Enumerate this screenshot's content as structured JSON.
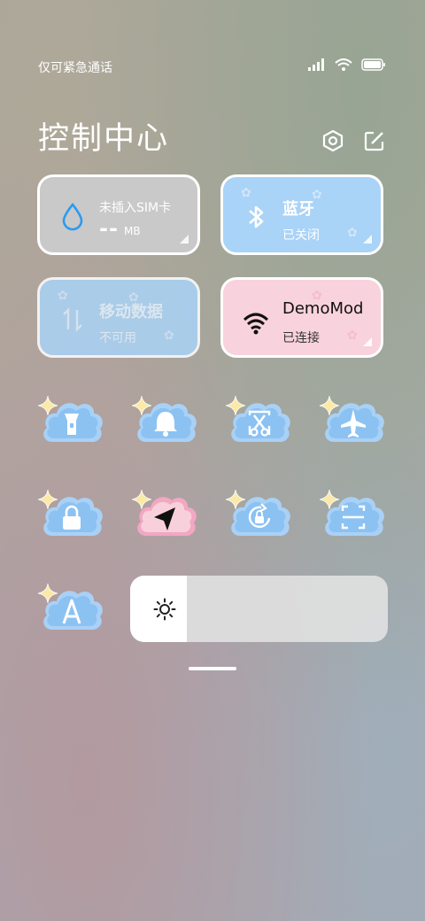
{
  "status_bar": {
    "text": "仅可紧急通话",
    "icons": [
      "signal-icon",
      "wifi-icon",
      "battery-icon"
    ]
  },
  "header": {
    "title": "控制中心",
    "icons": [
      "settings-icon",
      "edit-icon"
    ]
  },
  "tiles": {
    "data_usage": {
      "title": "未插入SIM卡",
      "value": "--",
      "unit": "MB"
    },
    "bluetooth": {
      "title": "蓝牙",
      "status": "已关闭"
    },
    "mobile_data": {
      "title": "移动数据",
      "status": "不可用"
    },
    "wifi": {
      "title": "DemoMod",
      "status": "已连接"
    }
  },
  "toggles": [
    {
      "name": "flashlight",
      "icon": "flashlight-icon",
      "active": false
    },
    {
      "name": "sound",
      "icon": "bell-icon",
      "active": false
    },
    {
      "name": "screenshot",
      "icon": "scissors-icon",
      "active": false
    },
    {
      "name": "airplane",
      "icon": "airplane-icon",
      "active": false
    },
    {
      "name": "lock-screen",
      "icon": "lock-icon",
      "active": false
    },
    {
      "name": "location",
      "icon": "location-arrow-icon",
      "active": true
    },
    {
      "name": "rotation-lock",
      "icon": "rotation-lock-icon",
      "active": false
    },
    {
      "name": "scanner",
      "icon": "scan-icon",
      "active": false
    },
    {
      "name": "font",
      "icon": "letter-a-icon",
      "active": false
    }
  ],
  "brightness": {
    "level": 0.22,
    "icon": "sun-icon"
  },
  "colors": {
    "tile_gray": "#c8c8c8",
    "tile_blue": "#a9d3f7",
    "tile_pink": "#f8d0dc",
    "cloud_blue": "#8cc2f2",
    "cloud_pink": "#f2a7c3",
    "accent_blue": "#2a9cf0"
  }
}
